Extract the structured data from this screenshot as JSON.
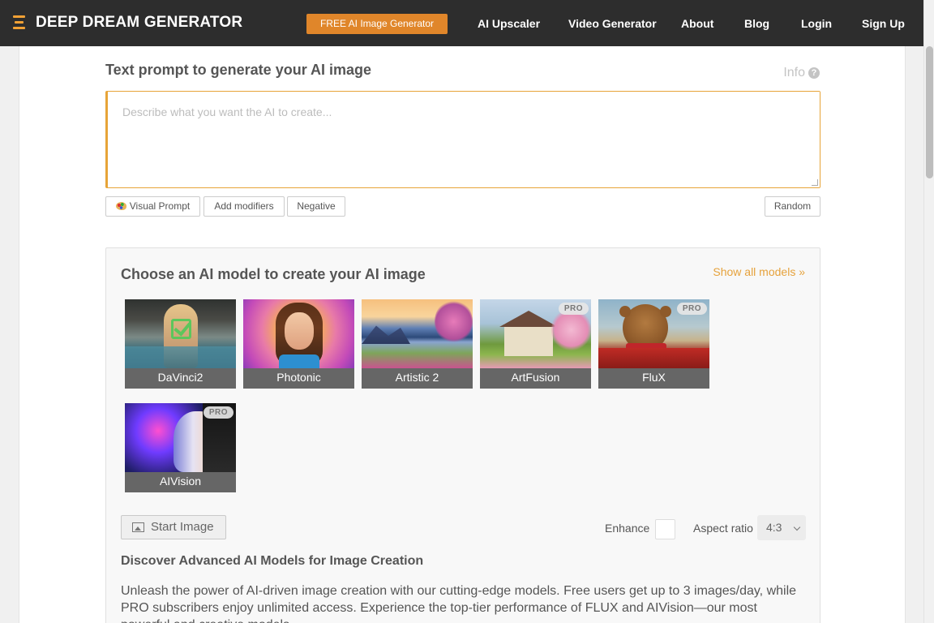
{
  "nav": {
    "brand": "DEEP DREAM GENERATOR",
    "free_button": "FREE AI Image Generator",
    "links": [
      "AI Upscaler",
      "Video Generator",
      "About",
      "Blog",
      "Login",
      "Sign Up"
    ]
  },
  "prompt": {
    "title": "Text prompt to generate your AI image",
    "info_label": "Info",
    "placeholder": "Describe what you want the AI to create...",
    "value": "",
    "buttons": {
      "visual_prompt": "Visual Prompt",
      "add_modifiers": "Add modifiers",
      "negative": "Negative",
      "random": "Random"
    }
  },
  "models": {
    "title": "Choose an AI model to create your AI image",
    "show_all": "Show all models",
    "items": [
      {
        "name": "DaVinci2",
        "pro": false,
        "selected": true
      },
      {
        "name": "Photonic",
        "pro": false,
        "selected": false
      },
      {
        "name": "Artistic 2",
        "pro": false,
        "selected": false
      },
      {
        "name": "ArtFusion",
        "pro": true,
        "selected": false
      },
      {
        "name": "FluX",
        "pro": true,
        "selected": false
      },
      {
        "name": "AIVision",
        "pro": true,
        "selected": false
      }
    ],
    "pro_badge": "PRO"
  },
  "controls": {
    "start_image": "Start Image",
    "enhance_label": "Enhance",
    "enhance_checked": false,
    "aspect_label": "Aspect ratio",
    "aspect_value": "4:3"
  },
  "discover": {
    "title": "Discover Advanced AI Models for Image Creation",
    "text": "Unleash the power of AI-driven image creation with our cutting-edge models. Free users get up to 3 images/day, while PRO subscribers enjoy unlimited access. Experience the top-tier performance of FLUX and AIVision—our most powerful and creative models."
  },
  "colors": {
    "topbar": "#2d2d2d",
    "accent": "#e0862a",
    "link_accent": "#e6a23c",
    "selected_check": "#5cc65c"
  }
}
